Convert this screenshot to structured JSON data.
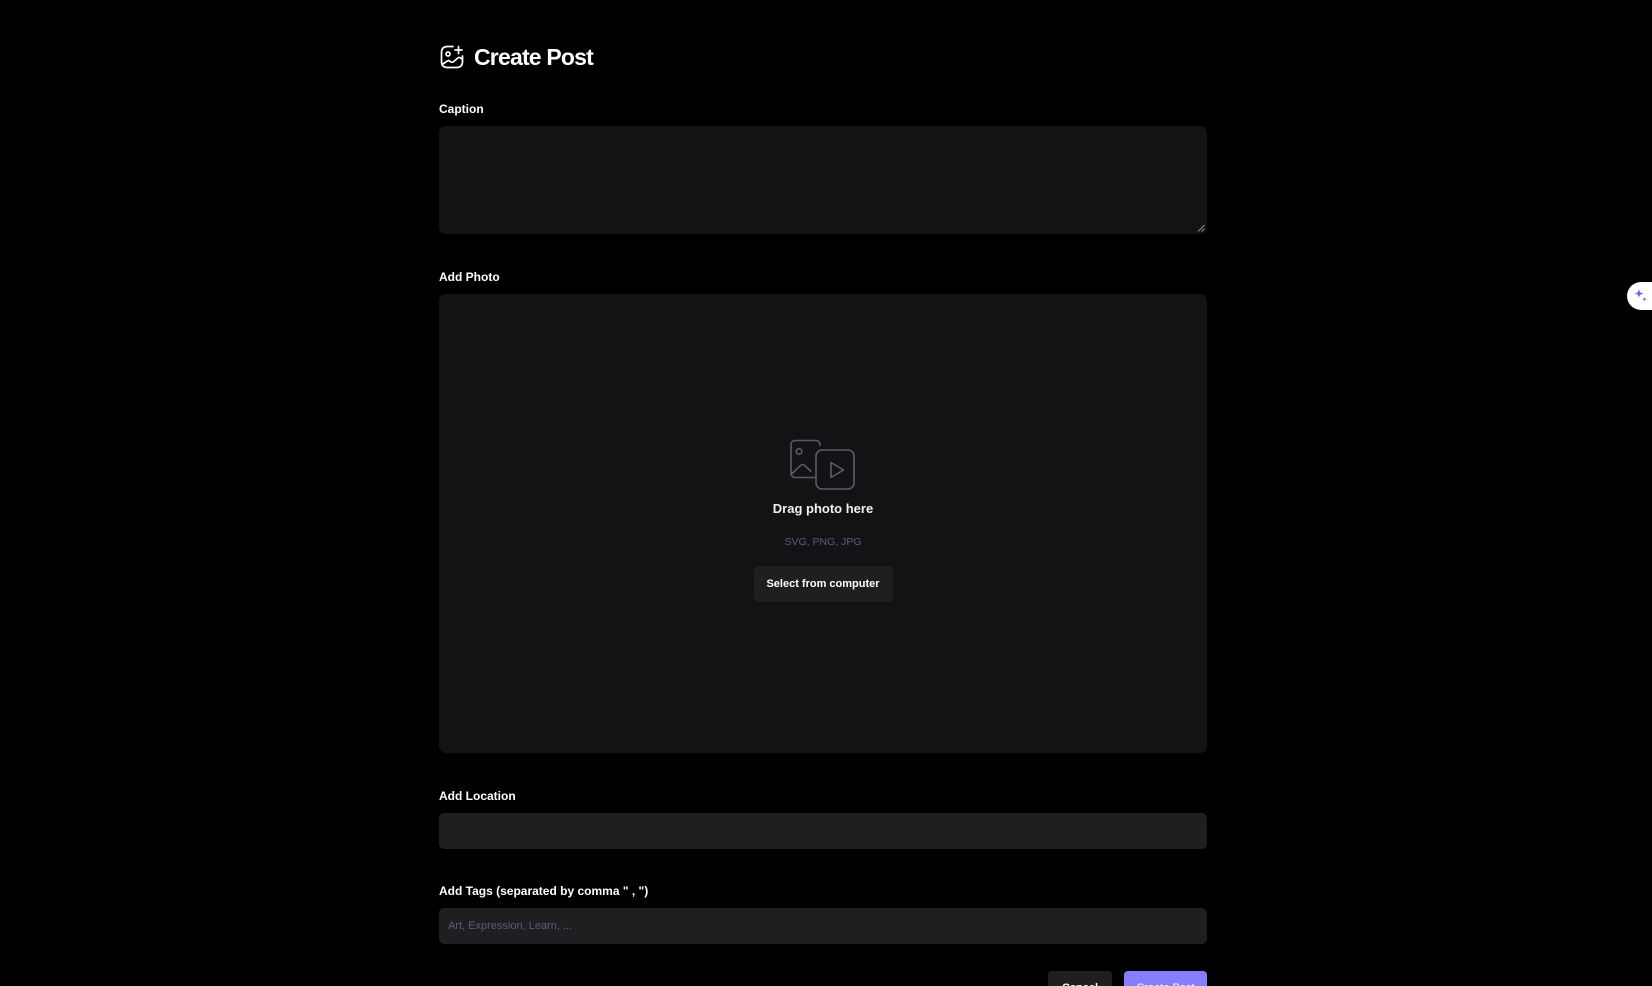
{
  "header": {
    "title": "Create Post",
    "icon": "gallery-add-icon"
  },
  "caption": {
    "label": "Caption",
    "value": ""
  },
  "photo": {
    "label": "Add Photo",
    "icon": "photo-video-icon",
    "drop_title": "Drag photo here",
    "formats": "SVG, PNG, JPG",
    "select_label": "Select from computer"
  },
  "location": {
    "label": "Add Location",
    "value": ""
  },
  "tags": {
    "label": "Add Tags (separated by comma \" , \")",
    "placeholder": "Art, Expression, Learn, ..."
  },
  "actions": {
    "cancel_label": "Cancel",
    "submit_label": "Create Post"
  },
  "colors": {
    "background": "#000000",
    "field": "#131316",
    "input": "#1f1f22",
    "accent": "#877eff",
    "muted": "#5c5c7b"
  },
  "side_widget": {
    "icon": "sparkle-icon"
  }
}
